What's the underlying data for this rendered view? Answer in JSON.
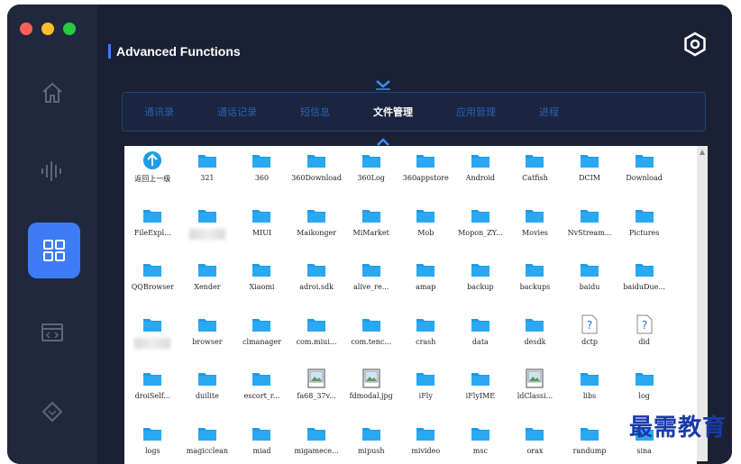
{
  "window": {
    "traffic_lights": [
      "#ff5f57",
      "#febc2e",
      "#28c840"
    ]
  },
  "sidebar": {
    "items": [
      {
        "icon": "home-icon"
      },
      {
        "icon": "audio-wave-icon"
      },
      {
        "icon": "apps-grid-icon",
        "active": true
      },
      {
        "icon": "code-window-icon"
      },
      {
        "icon": "diamond-icon"
      }
    ]
  },
  "header": {
    "title": "Advanced Functions",
    "settings_icon": "hexagon-settings-icon"
  },
  "tabs": [
    {
      "label": "通讯录"
    },
    {
      "label": "通话记录"
    },
    {
      "label": "短信息"
    },
    {
      "label": "文件管理",
      "active": true
    },
    {
      "label": "应用管理"
    },
    {
      "label": "进程"
    }
  ],
  "files": [
    {
      "name": "返回上一级",
      "type": "up"
    },
    {
      "name": "321",
      "type": "folder"
    },
    {
      "name": "360",
      "type": "folder"
    },
    {
      "name": "360Download",
      "type": "folder"
    },
    {
      "name": "360Log",
      "type": "folder"
    },
    {
      "name": "360appstore",
      "type": "folder"
    },
    {
      "name": "Android",
      "type": "folder"
    },
    {
      "name": "Catfish",
      "type": "folder"
    },
    {
      "name": "DCIM",
      "type": "folder"
    },
    {
      "name": "Download",
      "type": "folder"
    },
    {
      "name": "FileExpl...",
      "type": "folder"
    },
    {
      "name": "",
      "type": "folder",
      "blurred": true
    },
    {
      "name": "MIUI",
      "type": "folder"
    },
    {
      "name": "Maikonger",
      "type": "folder"
    },
    {
      "name": "MiMarket",
      "type": "folder"
    },
    {
      "name": "Mob",
      "type": "folder"
    },
    {
      "name": "Mopon_ZY...",
      "type": "folder"
    },
    {
      "name": "Movies",
      "type": "folder"
    },
    {
      "name": "NvStream...",
      "type": "folder"
    },
    {
      "name": "Pictures",
      "type": "folder"
    },
    {
      "name": "QQBrowser",
      "type": "folder"
    },
    {
      "name": "Xender",
      "type": "folder"
    },
    {
      "name": "Xiaomi",
      "type": "folder"
    },
    {
      "name": "adroi.sdk",
      "type": "folder"
    },
    {
      "name": "alive_re...",
      "type": "folder"
    },
    {
      "name": "amap",
      "type": "folder"
    },
    {
      "name": "backup",
      "type": "folder"
    },
    {
      "name": "backups",
      "type": "folder"
    },
    {
      "name": "baidu",
      "type": "folder"
    },
    {
      "name": "baiduDue...",
      "type": "folder"
    },
    {
      "name": "",
      "type": "folder",
      "blurred": true
    },
    {
      "name": "browser",
      "type": "folder"
    },
    {
      "name": "clmanager",
      "type": "folder"
    },
    {
      "name": "com.miui...",
      "type": "folder"
    },
    {
      "name": "com.tenc...",
      "type": "folder"
    },
    {
      "name": "crash",
      "type": "folder"
    },
    {
      "name": "data",
      "type": "folder"
    },
    {
      "name": "desdk",
      "type": "folder"
    },
    {
      "name": "dctp",
      "type": "unknown"
    },
    {
      "name": "did",
      "type": "unknown"
    },
    {
      "name": "droiSelf...",
      "type": "folder"
    },
    {
      "name": "duilite",
      "type": "folder"
    },
    {
      "name": "escort_r...",
      "type": "folder"
    },
    {
      "name": "fa68_37v...",
      "type": "image"
    },
    {
      "name": "fdmodal.jpg",
      "type": "image"
    },
    {
      "name": "iFly",
      "type": "folder"
    },
    {
      "name": "iFlyIME",
      "type": "folder"
    },
    {
      "name": "ldClassi...",
      "type": "image"
    },
    {
      "name": "libs",
      "type": "folder"
    },
    {
      "name": "log",
      "type": "folder"
    },
    {
      "name": "logs",
      "type": "folder"
    },
    {
      "name": "magicclean",
      "type": "folder"
    },
    {
      "name": "miad",
      "type": "folder"
    },
    {
      "name": "migamece...",
      "type": "folder"
    },
    {
      "name": "mipush",
      "type": "folder"
    },
    {
      "name": "mivideo",
      "type": "folder"
    },
    {
      "name": "msc",
      "type": "folder"
    },
    {
      "name": "orax",
      "type": "folder"
    },
    {
      "name": "randump",
      "type": "folder"
    },
    {
      "name": "sina",
      "type": "folder"
    }
  ],
  "watermark": "最需教育",
  "colors": {
    "accent": "#3d7cf4",
    "folder": "#1e9be8",
    "tab_inactive": "#2b5fb8"
  }
}
